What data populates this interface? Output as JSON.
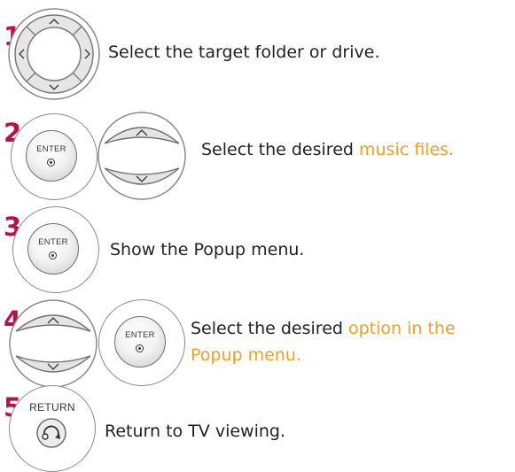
{
  "steps": [
    {
      "number": "1",
      "icons": [
        "navigation-pad"
      ],
      "text_before": "Select the target folder or drive.",
      "highlight": ""
    },
    {
      "number": "2",
      "icons": [
        "enter-button",
        "up-down-buttons"
      ],
      "text_before": "Select the desired ",
      "highlight": "music files."
    },
    {
      "number": "3",
      "icons": [
        "enter-button"
      ],
      "text_before": "Show the Popup menu.",
      "highlight": ""
    },
    {
      "number": "4",
      "icons": [
        "up-down-buttons",
        "enter-button"
      ],
      "text_before": "Select the desired  ",
      "highlight": "option in the",
      "highlight_line2": "Popup menu."
    },
    {
      "number": "5",
      "icons": [
        "return-button"
      ],
      "text_before": "Return to TV viewing.",
      "highlight": ""
    }
  ],
  "buttons": {
    "enter_label": "ENTER",
    "return_label": "RETURN"
  },
  "colors": {
    "step_number": "#b5124e",
    "highlight": "#f0a020",
    "text": "#222222"
  }
}
